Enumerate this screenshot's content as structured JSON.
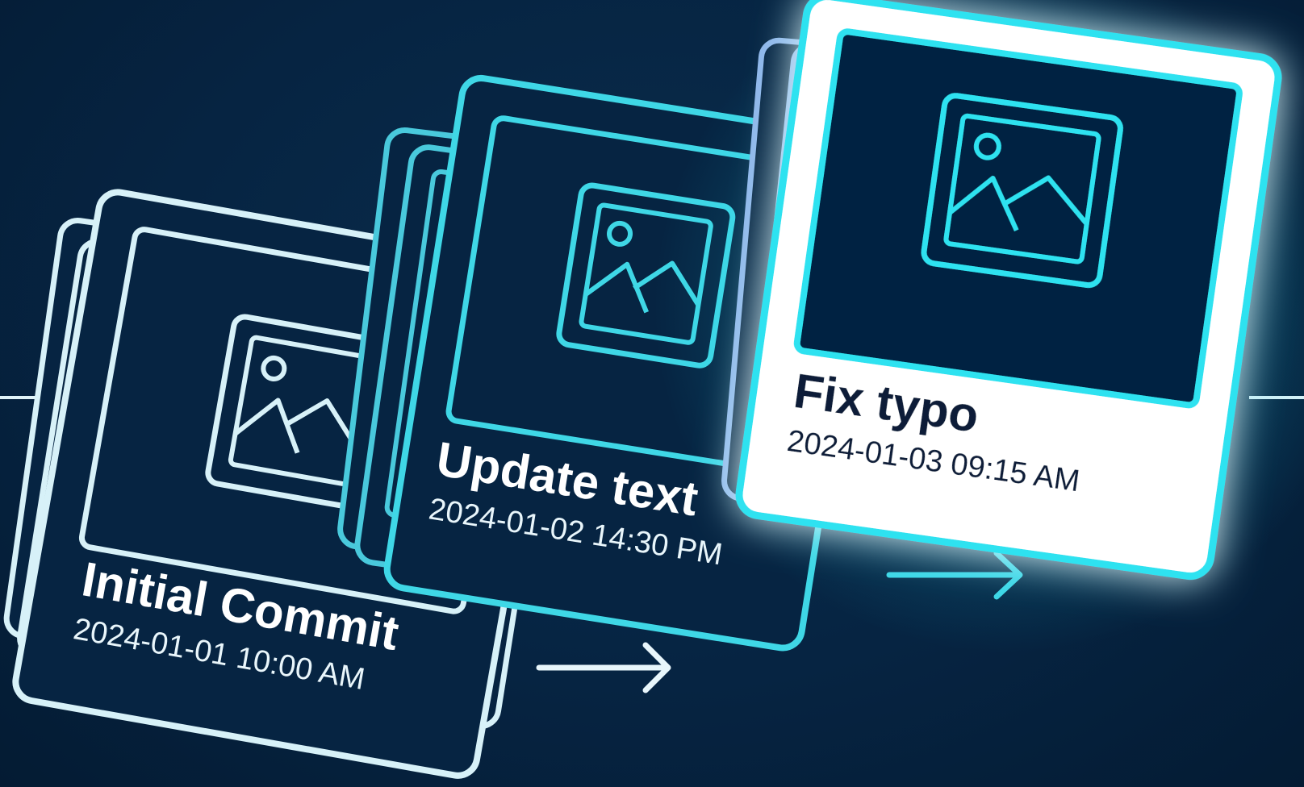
{
  "commits": [
    {
      "title": "Initial Commit",
      "timestamp": "2024-01-01 10:00 AM",
      "stroke": "#d7f1f8",
      "state": "past"
    },
    {
      "title": "Update text",
      "timestamp": "2024-01-02 14:30 PM",
      "stroke": "#3fd7e6",
      "state": "past"
    },
    {
      "title": "Fix typo",
      "timestamp": "2024-01-03 09:15 AM",
      "stroke": "#2fe2f0",
      "state": "current"
    }
  ],
  "colors": {
    "background": "#062442",
    "card_fill": "#062442",
    "current_card_fill": "#ffffff",
    "back_card_stroke_blue": "#8fb6ea",
    "glow": "#1ed6ee",
    "arrow_light": "#e8f6fb",
    "arrow_cyan": "#3fd7e6",
    "timeline": "#dff3f8"
  },
  "icons": [
    "image-placeholder-icon",
    "arrow-right-icon"
  ]
}
